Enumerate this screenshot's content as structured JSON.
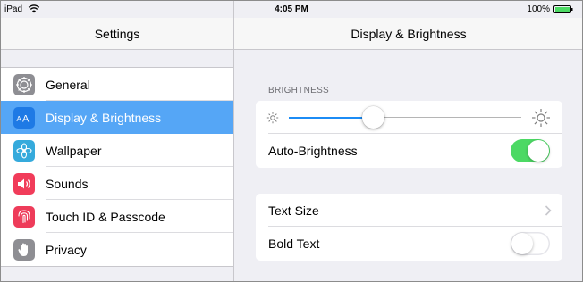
{
  "status_bar": {
    "device": "iPad",
    "time": "4:05 PM",
    "battery": "100%"
  },
  "master": {
    "title": "Settings",
    "items": [
      {
        "label": "General",
        "icon": "gear-icon",
        "color": "#8e8e93",
        "selected": false
      },
      {
        "label": "Display & Brightness",
        "icon": "text-size-icon",
        "color": "#1e7ae5",
        "selected": true
      },
      {
        "label": "Wallpaper",
        "icon": "wallpaper-icon",
        "color": "#35aadc",
        "selected": false
      },
      {
        "label": "Sounds",
        "icon": "speaker-icon",
        "color": "#f13c5a",
        "selected": false
      },
      {
        "label": "Touch ID & Passcode",
        "icon": "fingerprint-icon",
        "color": "#ee3c5a",
        "selected": false
      },
      {
        "label": "Privacy",
        "icon": "hand-icon",
        "color": "#8e8e93",
        "selected": false
      }
    ]
  },
  "detail": {
    "title": "Display & Brightness",
    "brightness_section": "BRIGHTNESS",
    "brightness_level": 0.36,
    "auto_brightness": {
      "label": "Auto-Brightness",
      "on": true
    },
    "text_size": {
      "label": "Text Size"
    },
    "bold_text": {
      "label": "Bold Text",
      "on": false
    }
  },
  "colors": {
    "selection": "#55a6f6",
    "accent": "#1c8cf5",
    "toggle_on": "#4cd964",
    "background": "#efeff4"
  }
}
